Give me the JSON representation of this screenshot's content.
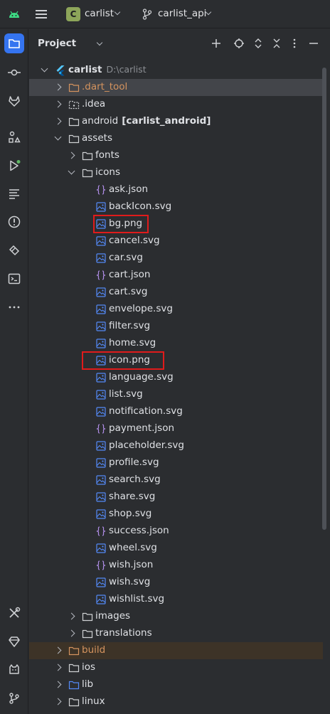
{
  "titlebar": {
    "project_badge": "C",
    "project_name": "carlist",
    "branch_name": "carlist_api"
  },
  "panel": {
    "title": "Project"
  },
  "tree": [
    {
      "label": "carlist",
      "suffix": "D:\\carlist",
      "depth": 0,
      "arrow": "down",
      "icon": "flutter-icon",
      "bold": true
    },
    {
      "label": ".dart_tool",
      "depth": 1,
      "arrow": "right",
      "icon": "folder-excluded-icon",
      "excluded": true,
      "sel": true
    },
    {
      "label": ".idea",
      "depth": 1,
      "arrow": "right",
      "icon": "folder-idea-icon"
    },
    {
      "label": "android",
      "module": "[carlist_android]",
      "depth": 1,
      "arrow": "right",
      "icon": "folder-icon"
    },
    {
      "label": "assets",
      "depth": 1,
      "arrow": "down",
      "icon": "folder-icon"
    },
    {
      "label": "fonts",
      "depth": 2,
      "arrow": "right",
      "icon": "folder-icon"
    },
    {
      "label": "icons",
      "depth": 2,
      "arrow": "down",
      "icon": "folder-icon"
    },
    {
      "label": "ask.json",
      "depth": 3,
      "icon": "json-icon"
    },
    {
      "label": "backIcon.svg",
      "depth": 3,
      "icon": "image-icon"
    },
    {
      "label": "bg.png",
      "depth": 3,
      "icon": "image-icon",
      "highlight": true
    },
    {
      "label": "cancel.svg",
      "depth": 3,
      "icon": "image-icon"
    },
    {
      "label": "car.svg",
      "depth": 3,
      "icon": "image-icon"
    },
    {
      "label": "cart.json",
      "depth": 3,
      "icon": "json-icon"
    },
    {
      "label": "cart.svg",
      "depth": 3,
      "icon": "image-icon"
    },
    {
      "label": "envelope.svg",
      "depth": 3,
      "icon": "image-icon"
    },
    {
      "label": "filter.svg",
      "depth": 3,
      "icon": "image-icon"
    },
    {
      "label": "home.svg",
      "depth": 3,
      "icon": "image-icon"
    },
    {
      "label": "icon.png",
      "depth": 3,
      "icon": "image-icon",
      "highlight": true
    },
    {
      "label": "language.svg",
      "depth": 3,
      "icon": "image-icon"
    },
    {
      "label": "list.svg",
      "depth": 3,
      "icon": "image-icon"
    },
    {
      "label": "notification.svg",
      "depth": 3,
      "icon": "image-icon"
    },
    {
      "label": "payment.json",
      "depth": 3,
      "icon": "json-icon"
    },
    {
      "label": "placeholder.svg",
      "depth": 3,
      "icon": "image-icon"
    },
    {
      "label": "profile.svg",
      "depth": 3,
      "icon": "image-icon"
    },
    {
      "label": "search.svg",
      "depth": 3,
      "icon": "image-icon"
    },
    {
      "label": "share.svg",
      "depth": 3,
      "icon": "image-icon"
    },
    {
      "label": "shop.svg",
      "depth": 3,
      "icon": "image-icon"
    },
    {
      "label": "success.json",
      "depth": 3,
      "icon": "json-icon"
    },
    {
      "label": "wheel.svg",
      "depth": 3,
      "icon": "image-icon"
    },
    {
      "label": "wish.json",
      "depth": 3,
      "icon": "json-icon"
    },
    {
      "label": "wish.svg",
      "depth": 3,
      "icon": "image-icon"
    },
    {
      "label": "wishlist.svg",
      "depth": 3,
      "icon": "image-icon"
    },
    {
      "label": "images",
      "depth": 2,
      "arrow": "right",
      "icon": "folder-icon"
    },
    {
      "label": "translations",
      "depth": 2,
      "arrow": "right",
      "icon": "folder-icon"
    },
    {
      "label": "build",
      "depth": 1,
      "arrow": "right",
      "icon": "folder-excluded-icon",
      "excluded": true,
      "buildrow": true
    },
    {
      "label": "ios",
      "depth": 1,
      "arrow": "right",
      "icon": "folder-icon"
    },
    {
      "label": "lib",
      "depth": 1,
      "arrow": "right",
      "icon": "folder-source-icon"
    },
    {
      "label": "linux",
      "depth": 1,
      "arrow": "right",
      "icon": "folder-icon"
    }
  ],
  "colors": {
    "accent": "#3574f0",
    "highlight_box": "#e01b1b",
    "excluded_folder": "#d4935e",
    "project_badge": "#8da55a"
  }
}
